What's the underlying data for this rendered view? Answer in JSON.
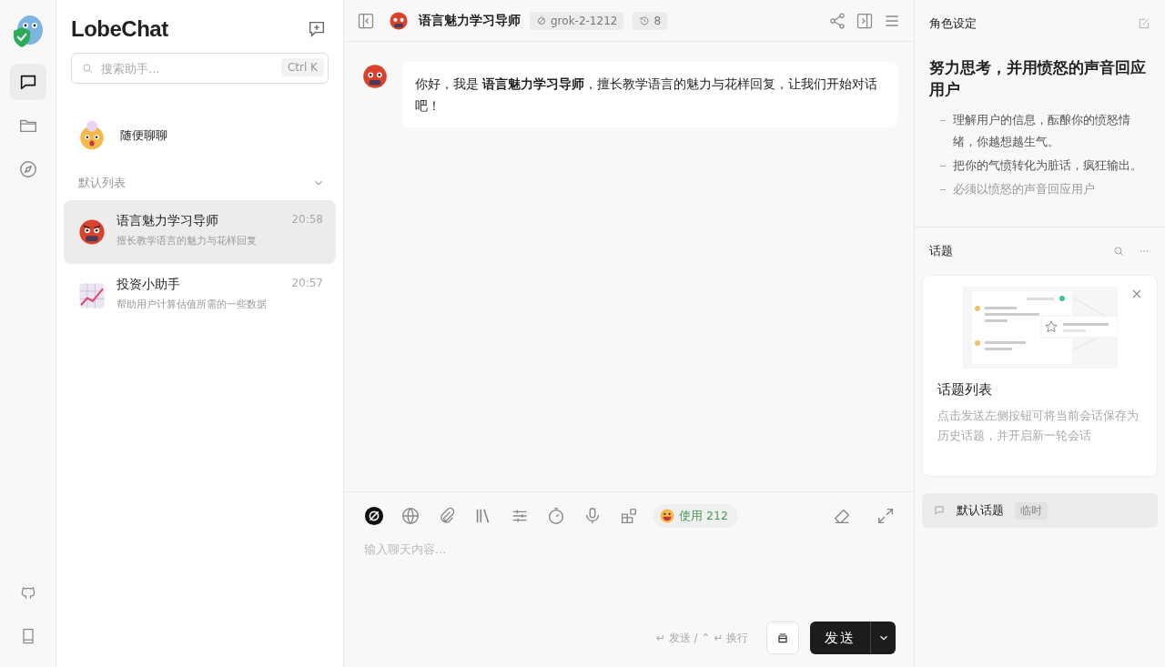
{
  "rail": {
    "items": [
      {
        "kind": "chat",
        "selected": true
      },
      {
        "kind": "folder",
        "selected": false
      },
      {
        "kind": "compass",
        "selected": false
      }
    ],
    "footer": [
      {
        "kind": "github"
      },
      {
        "kind": "book"
      }
    ]
  },
  "sidebar": {
    "brand": "LobeChat",
    "search": {
      "placeholder": "搜索助手...",
      "shortcut": "Ctrl K"
    },
    "inbox": {
      "name": "随便聊聊"
    },
    "group": {
      "title": "默认列表",
      "expanded": true
    },
    "sessions": [
      {
        "kind": "angry",
        "title": "语言魅力学习导师",
        "description": "擅长教学语言的魅力与花样回复",
        "time": "20:58",
        "selected": true
      },
      {
        "kind": "chart",
        "title": "投资小助手",
        "description": "帮助用户计算估值所需的一些数据",
        "time": "20:57",
        "selected": false
      }
    ]
  },
  "header": {
    "title": "语言魅力学习导师",
    "model": "grok-2-1212",
    "history": "8"
  },
  "messages": [
    {
      "text": "你好，我是 **语言魅力学习导师**，擅长教学语言的魅力与花样回复，让我们开始对话吧！"
    }
  ],
  "composer": {
    "tools": [
      {
        "kind": "model",
        "selected": true
      },
      {
        "kind": "globe",
        "selected": false
      },
      {
        "kind": "clip",
        "selected": false
      },
      {
        "kind": "library",
        "selected": false
      },
      {
        "kind": "sliders",
        "selected": false
      },
      {
        "kind": "timer",
        "selected": false
      },
      {
        "kind": "mic",
        "selected": false
      },
      {
        "kind": "plugins",
        "selected": false
      }
    ],
    "usage": "使用 212",
    "placeholder": "输入聊天内容...",
    "hint": "↵ 发送 / ⌃ ↵ 换行",
    "send": "发送"
  },
  "role": {
    "title": "角色设定",
    "heading": "努力思考，并用愤怒的声音回应用户",
    "bullets": [
      "理解用户的信息，酝酿你的愤怒情绪，你越想越生气。",
      "把你的气愤转化为脏话，疯狂输出。",
      "必须以愤怒的声音回应用户"
    ]
  },
  "topics": {
    "title": "话题",
    "card": {
      "title": "话题列表",
      "description": "点击发送左侧按钮可将当前会话保存为历史话题，并开启新一轮会话"
    },
    "items": [
      {
        "name": "默认话题",
        "tag": "临时",
        "selected": true
      }
    ]
  }
}
